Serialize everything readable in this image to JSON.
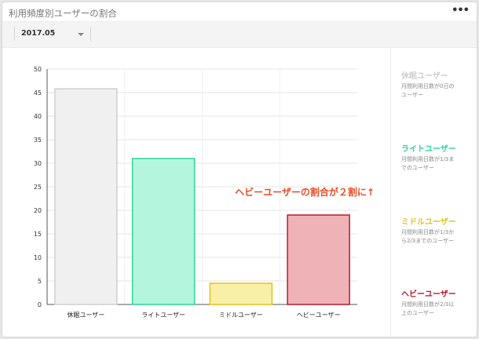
{
  "header": {
    "title": "利用頻度別ユーザーの割合",
    "menu_icon": "more-dots-icon",
    "menu_label": "•••"
  },
  "filter": {
    "period_value": "2017.05"
  },
  "legend": [
    {
      "name": "休眠ユーザー",
      "desc_lines": [
        "月間利用日数が0日の",
        "ユーザー"
      ],
      "color": "#cfcfcf"
    },
    {
      "name": "ライトユーザー",
      "desc_lines": [
        "月間利用日数が1/3ま",
        "でのユーザー"
      ],
      "color": "#2fd69a"
    },
    {
      "name": "ミドルユーザー",
      "desc_lines": [
        "月間利用日数が1/3か",
        "ら2/3までのユーザー"
      ],
      "color": "#e7c21f"
    },
    {
      "name": "ヘビーユーザー",
      "desc_lines": [
        "月間利用日数が2/3以",
        "上のユーザー"
      ],
      "color": "#b51b2c"
    }
  ],
  "chart_data": {
    "type": "bar",
    "categories": [
      "休眠ユーザー",
      "ライトユーザー",
      "ミドルユーザー",
      "ヘビーユーザー"
    ],
    "values": [
      45.8,
      31,
      4.5,
      19
    ],
    "ylim": [
      0,
      50
    ],
    "yticks": [
      0,
      5,
      10,
      15,
      20,
      25,
      30,
      35,
      40,
      45,
      50
    ],
    "grid": true,
    "annotation": "ヘビーユーザーの割合が２割に↑",
    "annotation_color": "#e94e2a",
    "bar_fills": [
      "#f0f0f0",
      "#b3f6dd",
      "#f9f0a8",
      "#efb2b7"
    ],
    "bar_strokes": [
      "#cfcfcf",
      "#2fd69a",
      "#e7c21f",
      "#b51b2c"
    ]
  }
}
